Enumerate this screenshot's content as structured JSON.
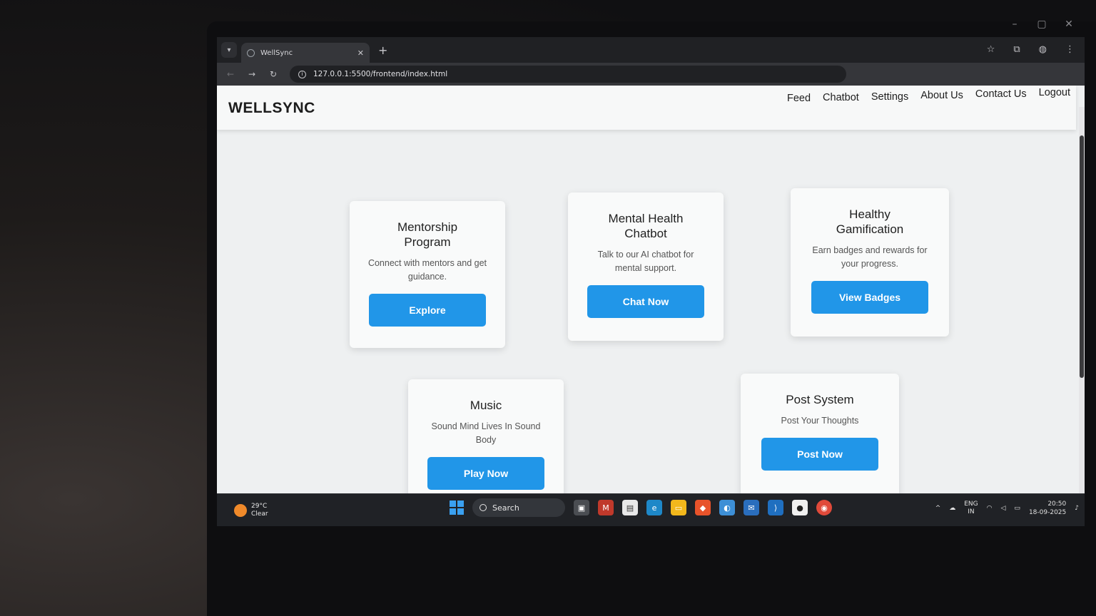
{
  "window_controls": [
    "–",
    "▢",
    "✕"
  ],
  "browser": {
    "tab_title": "WellSync",
    "url": "127.0.0.1:5500/frontend/index.html"
  },
  "site": {
    "brand": "WELLSYNC",
    "nav": [
      "Feed",
      "Chatbot",
      "Settings",
      "About Us",
      "Contact Us",
      "Logout"
    ]
  },
  "cards": [
    {
      "title": "Mentorship Program",
      "desc": "Connect with mentors and get guidance.",
      "button": "Explore"
    },
    {
      "title": "Mental Health Chatbot",
      "desc": "Talk to our AI chatbot for mental support.",
      "button": "Chat Now"
    },
    {
      "title": "Healthy Gamification",
      "desc": "Earn badges and rewards for your progress.",
      "button": "View Badges"
    },
    {
      "title": "Music",
      "desc": "Sound Mind Lives In Sound Body",
      "button": "Play Now"
    },
    {
      "title": "Post System",
      "desc": "Post Your Thoughts",
      "button": "Post Now"
    }
  ],
  "taskbar": {
    "temperature": "29°C",
    "condition": "Clear",
    "search_label": "Search",
    "lang_top": "ENG",
    "lang_bottom": "IN",
    "time": "20:50",
    "date": "18-09-2025"
  },
  "colors": {
    "accent_button": "#2196e8",
    "page_bg": "#eef0f1"
  }
}
